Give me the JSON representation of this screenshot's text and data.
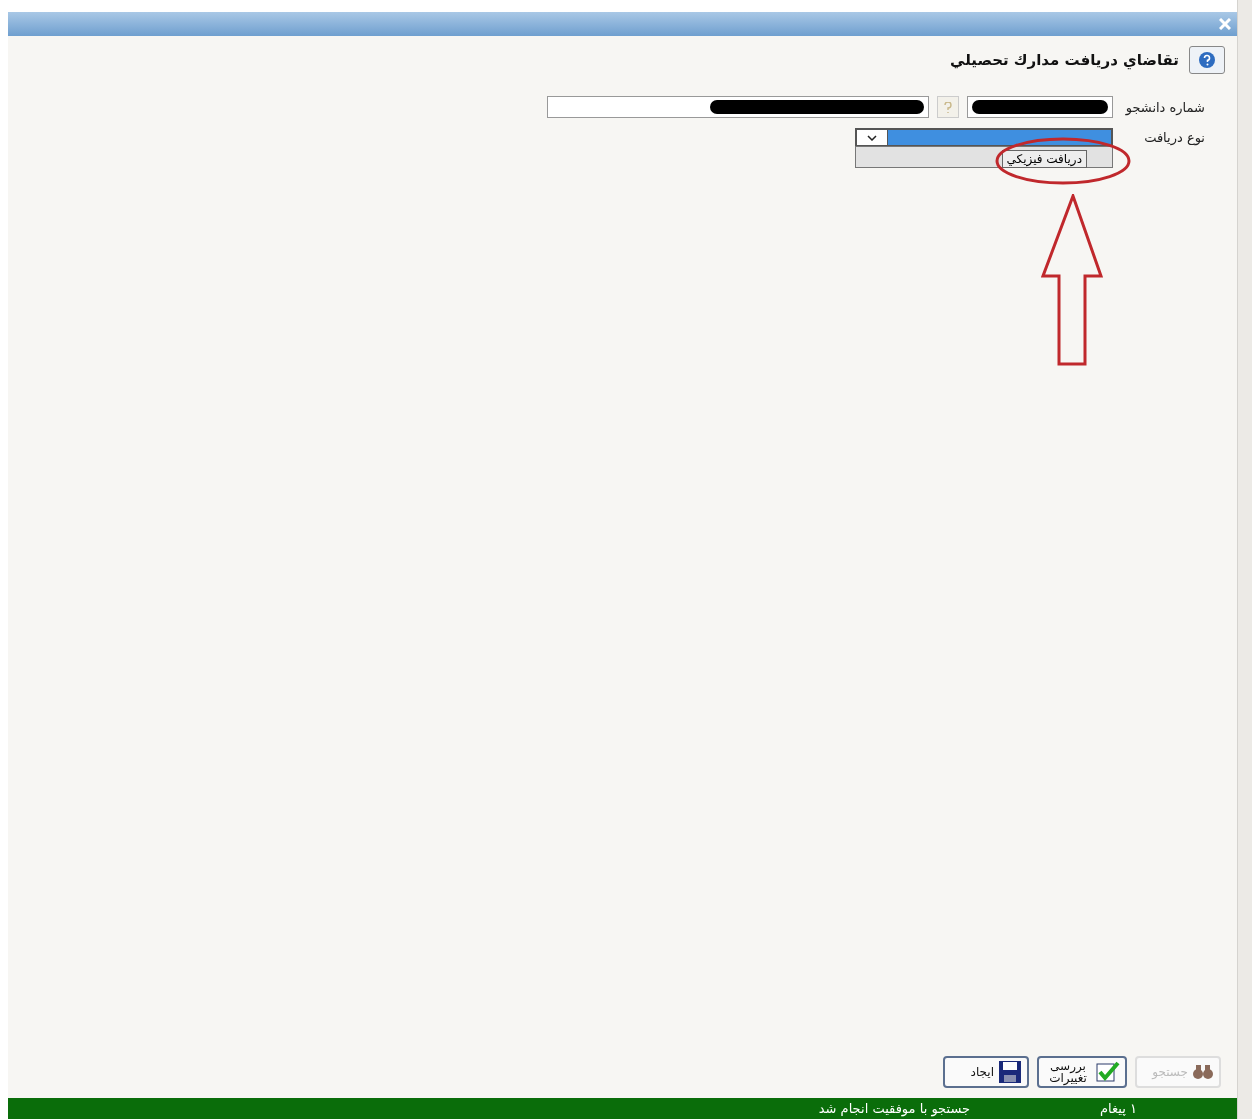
{
  "window": {
    "title": "تقاضاي دريافت مدارك تحصيلي"
  },
  "form": {
    "student_number": {
      "label": "شماره دانشجو",
      "help_disabled": true
    },
    "receipt_type": {
      "label": "نوع دريافت",
      "expanded": true,
      "options": [
        {
          "label": "دريافت فيزيكي",
          "selected": true
        }
      ]
    }
  },
  "buttons": [
    {
      "kind": "search",
      "label": "جستجو",
      "disabled": true
    },
    {
      "kind": "review",
      "label": "بررسی تغییرات",
      "disabled": false
    },
    {
      "kind": "save",
      "label": "ایجاد",
      "disabled": false
    }
  ],
  "status_bar": {
    "count": "۱ پیغام",
    "message": "جستجو با موفقیت انجام شد"
  }
}
